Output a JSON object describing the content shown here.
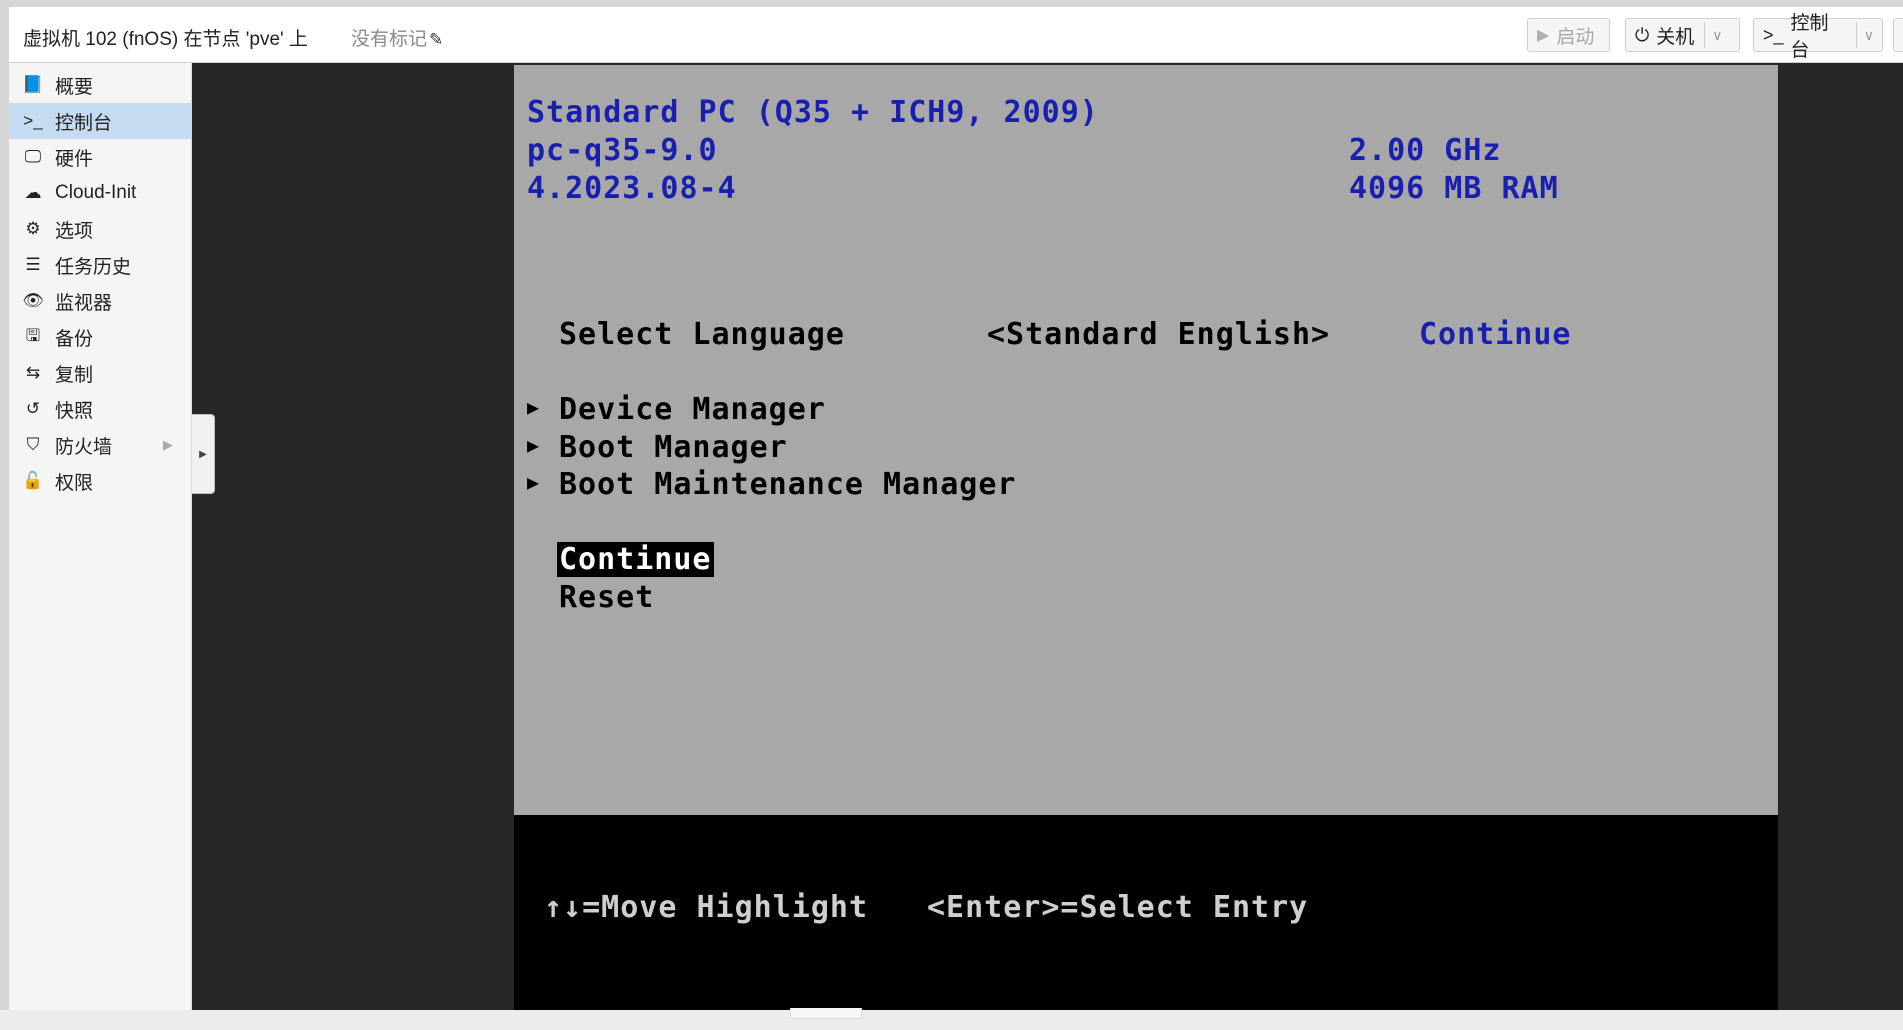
{
  "header": {
    "vm_title": "虚拟机 102 (fnOS) 在节点 'pve' 上",
    "tags_text": "没有标记",
    "buttons": {
      "start": "启动",
      "shutdown": "关机",
      "console": "控制台"
    }
  },
  "sidebar": {
    "items": [
      {
        "label": "概要",
        "icon": "book-icon"
      },
      {
        "label": "控制台",
        "icon": "terminal-icon",
        "active": true
      },
      {
        "label": "硬件",
        "icon": "desktop-icon"
      },
      {
        "label": "Cloud-Init",
        "icon": "cloud-icon"
      },
      {
        "label": "选项",
        "icon": "gear-icon"
      },
      {
        "label": "任务历史",
        "icon": "list-icon"
      },
      {
        "label": "监视器",
        "icon": "eye-icon"
      },
      {
        "label": "备份",
        "icon": "floppy-icon"
      },
      {
        "label": "复制",
        "icon": "retweet-icon"
      },
      {
        "label": "快照",
        "icon": "history-icon"
      },
      {
        "label": "防火墙",
        "icon": "shield-icon"
      },
      {
        "label": "权限",
        "icon": "unlock-icon"
      }
    ]
  },
  "bios": {
    "machine": "Standard PC (Q35 + ICH9, 2009)",
    "machine_type": "pc-q35-9.0",
    "firmware_version": "4.2023.08-4",
    "cpu_speed": "2.00 GHz",
    "ram": "4096 MB RAM",
    "select_language_label": "Select Language",
    "language_value": "<Standard English>",
    "continue_top": "Continue",
    "menu": [
      "Device Manager",
      "Boot Manager",
      "Boot Maintenance Manager"
    ],
    "continue_item": "Continue",
    "reset_item": "Reset",
    "footer_move": "↑↓=Move Highlight",
    "footer_enter": "<Enter>=Select Entry"
  }
}
